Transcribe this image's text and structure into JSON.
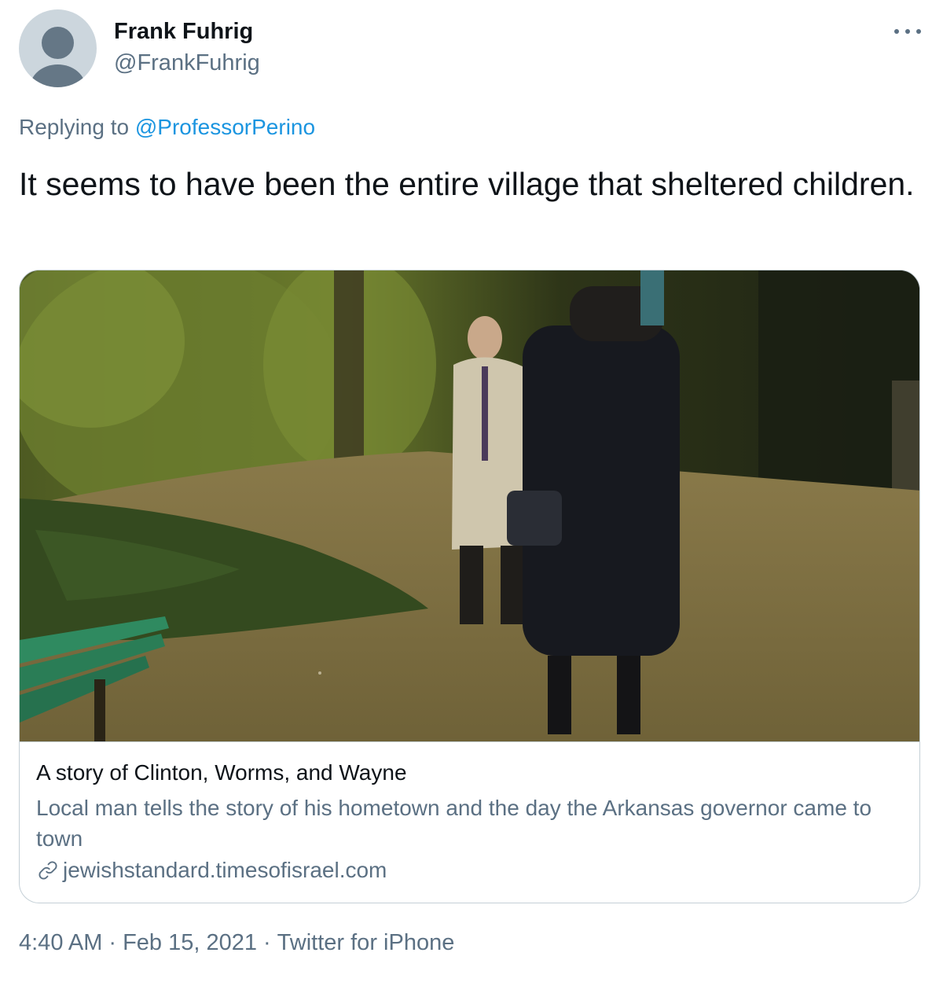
{
  "author": {
    "display_name": "Frank Fuhrig",
    "handle": "@FrankFuhrig",
    "avatar_icon": "default-profile-icon"
  },
  "more_icon": "more-options-icon",
  "reply": {
    "prefix": "Replying to",
    "mention": "@ProfessorPerino"
  },
  "tweet": {
    "text": "It seems to have been the entire village that sheltered children."
  },
  "card": {
    "title": "A story of Clinton, Worms, and Wayne",
    "description": "Local man tells the story of his hometown and the day the Arkansas governor came to town",
    "domain": "jewishstandard.timesofisrael.com",
    "link_icon": "link-icon"
  },
  "footer": {
    "time": "4:40 AM",
    "separator": "·",
    "date": "Feb 15, 2021",
    "source": "Twitter for iPhone"
  },
  "colors": {
    "text_primary": "#0f1419",
    "text_secondary": "#5b7083",
    "link": "#1b95e0",
    "border": "#c4cfd6"
  }
}
